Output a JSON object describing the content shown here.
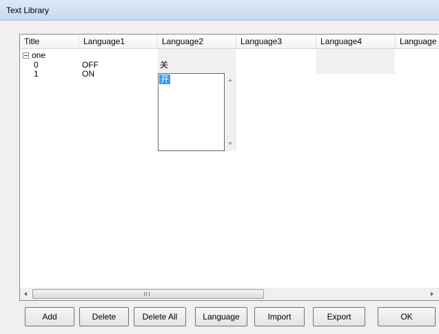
{
  "window": {
    "title": "Text Library"
  },
  "listview": {
    "columns": [
      "Title",
      "Language1",
      "Language2",
      "Language3",
      "Language4",
      "Language"
    ],
    "group": {
      "label": "one",
      "expanded": true
    },
    "rows": [
      {
        "title": "0",
        "language1": "OFF",
        "language2": "关"
      },
      {
        "title": "1",
        "language1": "ON",
        "language2": ""
      }
    ],
    "editor": {
      "options": [
        "开"
      ]
    }
  },
  "buttons": {
    "add": "Add",
    "delete": "Delete",
    "delete_all": "Delete All",
    "language": "Language",
    "import": "Import",
    "export": "Export",
    "ok": "OK"
  },
  "colors": {
    "titlebar": "#c6d9ee",
    "selection": "#3399ff",
    "background": "#f0f0f0"
  }
}
